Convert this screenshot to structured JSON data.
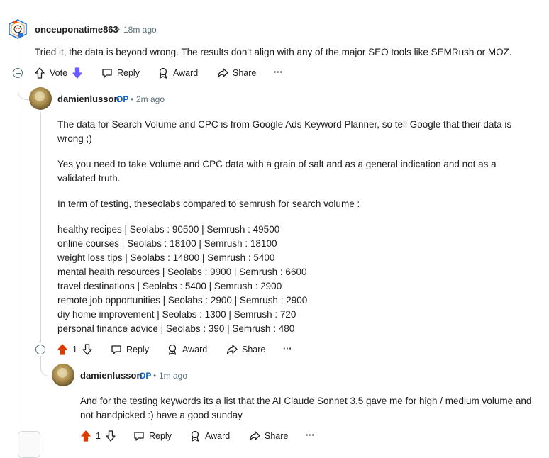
{
  "comment1": {
    "username": "onceuponatime863",
    "separator": "•",
    "time": "18m ago",
    "text": "Tried it, the data is beyond wrong. The results don't align with any of the major SEO tools like SEMRush or MOZ.",
    "actions": {
      "vote": "Vote",
      "reply": "Reply",
      "award": "Award",
      "share": "Share",
      "more": "···"
    }
  },
  "comment2": {
    "username": "damienlusson",
    "op": "OP",
    "separator": "•",
    "time": "2m ago",
    "paragraphs": [
      "The data for Search Volume and CPC is from Google Ads Keyword Planner, so tell Google that their data is wrong ;)",
      "Yes you need to take Volume and CPC data with a grain of salt and as a general indication and not as a validated truth.",
      "In term of testing, theseolabs compared to semrush for search volume :"
    ],
    "list": [
      "healthy recipes | Seolabs : 90500 | Semrush : 49500",
      "online courses | Seolabs : 18100 | Semrush : 18100",
      "weight loss tips | Seolabs : 14800 | Semrush : 5400",
      "mental health resources | Seolabs : 9900 | Semrush : 6600",
      "travel destinations | Seolabs : 5400 | Semrush : 2900",
      "remote job opportunities | Seolabs : 2900 | Semrush : 2900",
      "diy home improvement | Seolabs : 1300 | Semrush : 720",
      "personal finance advice | Seolabs : 390 | Semrush : 480"
    ],
    "score": "1",
    "actions": {
      "reply": "Reply",
      "award": "Award",
      "share": "Share",
      "more": "···"
    }
  },
  "comment3": {
    "username": "damienlusson",
    "op": "OP",
    "separator": "•",
    "time": "1m ago",
    "text": "And for the testing keywords its a list that the AI Claude Sonnet 3.5 gave me for high / medium volume and not handpicked :) have a good sunday",
    "score": "1",
    "actions": {
      "reply": "Reply",
      "award": "Award",
      "share": "Share",
      "more": "···"
    }
  },
  "colors": {
    "upvote_active": "#d93a00",
    "downvote_active": "#6a5cff",
    "op": "#0a63c9",
    "meta": "#576f76"
  }
}
